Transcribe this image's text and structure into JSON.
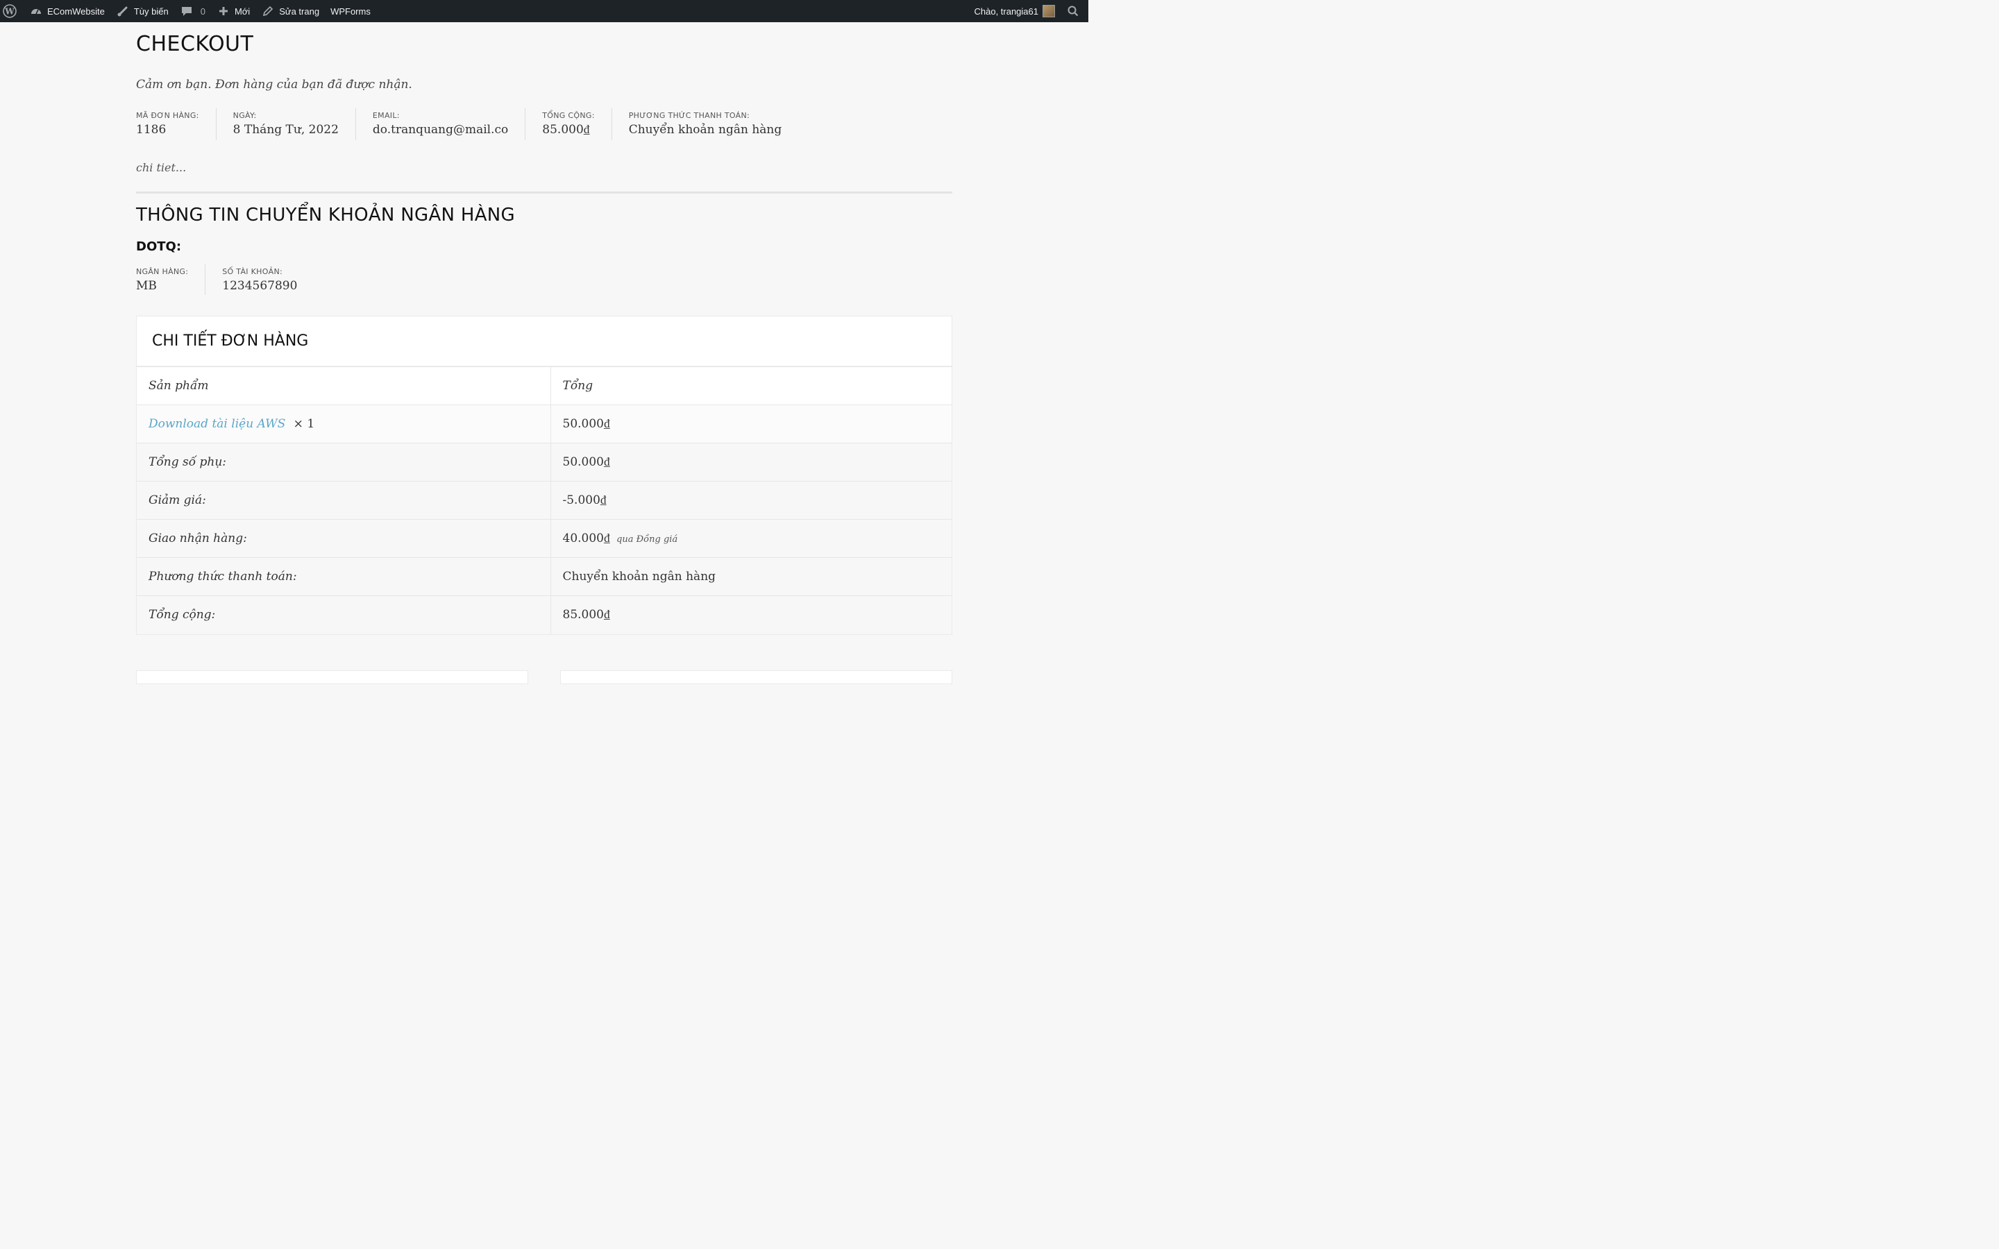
{
  "adminbar": {
    "site_name": "EComWebsite",
    "customize": "Tùy biến",
    "comments_count": "0",
    "new": "Mới",
    "edit_page": "Sửa trang",
    "wpforms": "WPForms",
    "greeting": "Chào, trangia61"
  },
  "page": {
    "title": "CHECKOUT",
    "thanks": "Cảm ơn bạn. Đơn hàng của bạn đã được nhận.",
    "note": "chi tiet..."
  },
  "overview": [
    {
      "label": "MÃ ĐƠN HÀNG:",
      "value": "1186"
    },
    {
      "label": "NGÀY:",
      "value": "8 Tháng Tư, 2022"
    },
    {
      "label": "EMAIL:",
      "value": "do.tranquang@mail.co"
    },
    {
      "label": "TỔNG CỘNG:",
      "value": "85.000₫"
    },
    {
      "label": "PHƯƠNG THỨC THANH TOÁN:",
      "value": "Chuyển khoản ngân hàng"
    }
  ],
  "bank": {
    "title": "THÔNG TIN CHUYỂN KHOẢN NGÂN HÀNG",
    "account_name": "DOTQ:",
    "details": [
      {
        "label": "NGÂN HÀNG:",
        "value": "MB"
      },
      {
        "label": "SỐ TÀI KHOẢN:",
        "value": "1234567890"
      }
    ]
  },
  "order": {
    "title": "CHI TIẾT ĐƠN HÀNG",
    "col_product": "Sản phẩm",
    "col_total": "Tổng",
    "item": {
      "name": "Download tài liệu AWS",
      "qty": "× 1",
      "total": "50.000₫"
    },
    "totals": [
      {
        "label": "Tổng số phụ:",
        "value": "50.000₫",
        "extra": ""
      },
      {
        "label": "Giảm giá:",
        "value": "-5.000₫",
        "extra": ""
      },
      {
        "label": "Giao nhận hàng:",
        "value": "40.000₫",
        "extra": "qua Đồng giá"
      },
      {
        "label": "Phương thức thanh toán:",
        "value": "Chuyển khoản ngân hàng",
        "extra": ""
      },
      {
        "label": "Tổng cộng:",
        "value": "85.000₫",
        "extra": ""
      }
    ]
  },
  "icons": {
    "wordpress": "wordpress-logo-icon",
    "dashboard": "dashboard-icon",
    "brush": "brush-icon",
    "comment": "comment-icon",
    "plus": "plus-icon",
    "pencil": "pencil-icon",
    "search": "search-icon"
  }
}
